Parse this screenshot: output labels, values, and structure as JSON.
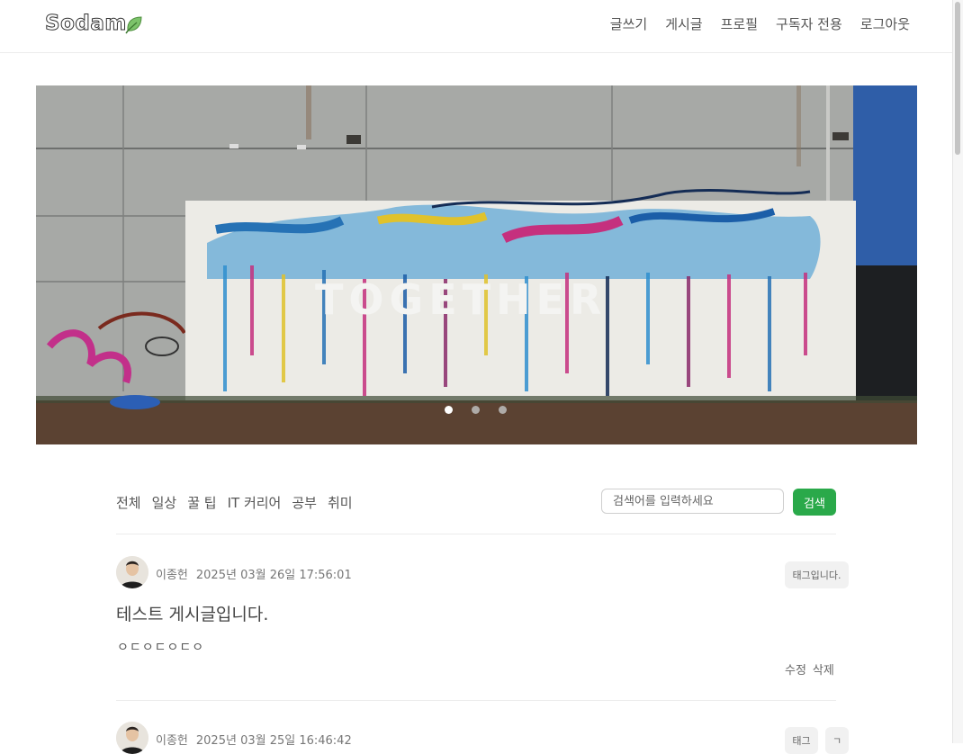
{
  "header": {
    "logo": "Sodam",
    "logo_icon": "leaf-icon",
    "nav": [
      "글쓰기",
      "게시글",
      "프로필",
      "구독자 전용",
      "로그아웃"
    ]
  },
  "carousel": {
    "image_text": "TOGETHER",
    "slide_count": 3,
    "active_slide": 1
  },
  "filters": [
    "전체",
    "일상",
    "꿀 팁",
    "IT 커리어",
    "공부",
    "취미"
  ],
  "search": {
    "placeholder": "검색어를 입력하세요",
    "button_label": "검색",
    "button_color": "#2aa94a"
  },
  "posts": [
    {
      "author": "이종헌",
      "date": "2025년 03월 26일 17:56:01",
      "tags": [
        "태그입니다."
      ],
      "title": "테스트 게시글입니다.",
      "body": "ㅇㄷㅇㄷㅇㄷㅇ",
      "actions": [
        "수정",
        "삭제"
      ]
    },
    {
      "author": "이종헌",
      "date": "2025년 03월 25일 16:46:42",
      "tags": [
        "태그",
        "ㄱ"
      ]
    }
  ]
}
